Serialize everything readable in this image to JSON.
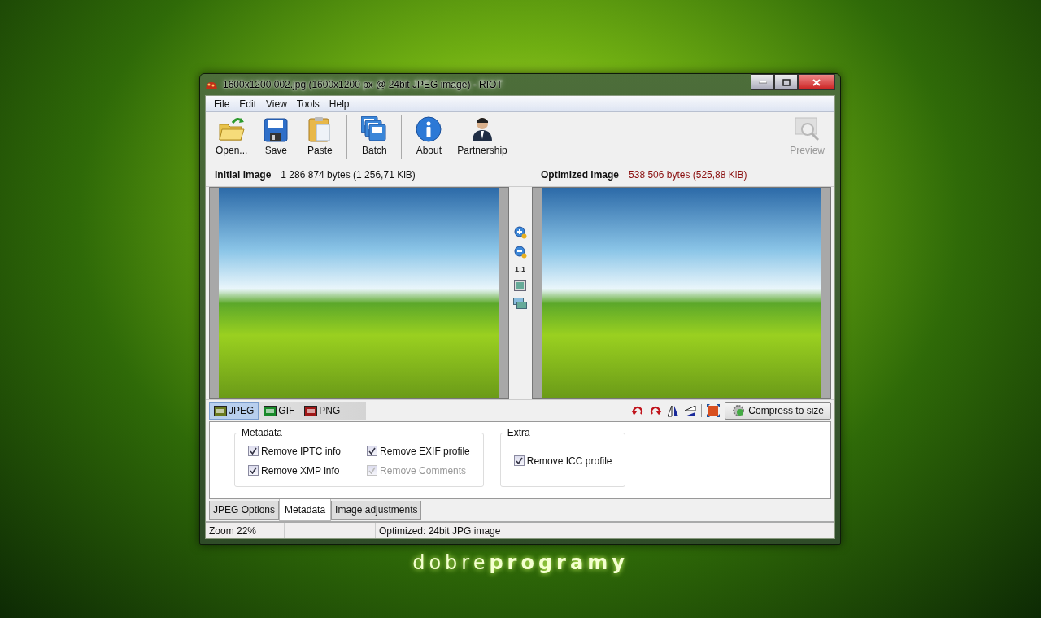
{
  "window": {
    "title": "1600x1200 002.jpg (1600x1200 px @ 24bit JPEG image) - RIOT"
  },
  "menu": [
    "File",
    "Edit",
    "View",
    "Tools",
    "Help"
  ],
  "toolbar": {
    "groups": [
      [
        {
          "kind": "open",
          "label": "Open...",
          "disabled": false
        },
        {
          "kind": "save",
          "label": "Save",
          "disabled": false
        },
        {
          "kind": "paste",
          "label": "Paste",
          "disabled": false
        }
      ],
      [
        {
          "kind": "batch",
          "label": "Batch",
          "disabled": false
        }
      ],
      [
        {
          "kind": "about",
          "label": "About",
          "disabled": false
        },
        {
          "kind": "partnership",
          "label": "Partnership",
          "disabled": false
        }
      ]
    ],
    "right": [
      {
        "kind": "preview",
        "label": "Preview",
        "disabled": true
      }
    ]
  },
  "initial": {
    "label": "Initial image",
    "size": "1 286 874 bytes (1 256,71 KiB)"
  },
  "optimized": {
    "label": "Optimized image",
    "size": "538 506 bytes (525,88 KiB)"
  },
  "zoom_tools": [
    {
      "kind": "zoom-in"
    },
    {
      "kind": "zoom-out"
    },
    {
      "kind": "text",
      "label": "1:1"
    },
    {
      "kind": "fit"
    },
    {
      "kind": "swap"
    }
  ],
  "format_tabs": [
    {
      "label": "JPEG",
      "selected": true
    },
    {
      "label": "GIF",
      "selected": false
    },
    {
      "label": "PNG",
      "selected": false
    }
  ],
  "actions": [
    {
      "kind": "rotate-left"
    },
    {
      "kind": "rotate-right"
    },
    {
      "kind": "flip-h"
    },
    {
      "kind": "flip-v"
    },
    {
      "kind": "separator"
    },
    {
      "kind": "resize"
    }
  ],
  "compress_button": "Compress to size",
  "groups": [
    {
      "title": "Metadata",
      "columns": [
        [
          {
            "label": "Remove IPTC info",
            "checked": true,
            "disabled": false
          },
          {
            "label": "Remove XMP info",
            "checked": true,
            "disabled": false
          }
        ],
        [
          {
            "label": "Remove EXIF profile",
            "checked": true,
            "disabled": false
          },
          {
            "label": "Remove Comments",
            "checked": true,
            "disabled": true
          }
        ]
      ]
    },
    {
      "title": "Extra",
      "columns": [
        [
          {
            "label": "Remove ICC profile",
            "checked": true,
            "disabled": false
          }
        ]
      ]
    }
  ],
  "bottom_tabs": [
    {
      "label": "JPEG Options",
      "selected": false
    },
    {
      "label": "Metadata",
      "selected": true
    },
    {
      "label": "Image adjustments",
      "selected": false
    }
  ],
  "status_bar": [
    "Zoom 22%",
    "Optimized: 24bit JPG image"
  ],
  "wallpaper_text": "dobre**programy**"
}
